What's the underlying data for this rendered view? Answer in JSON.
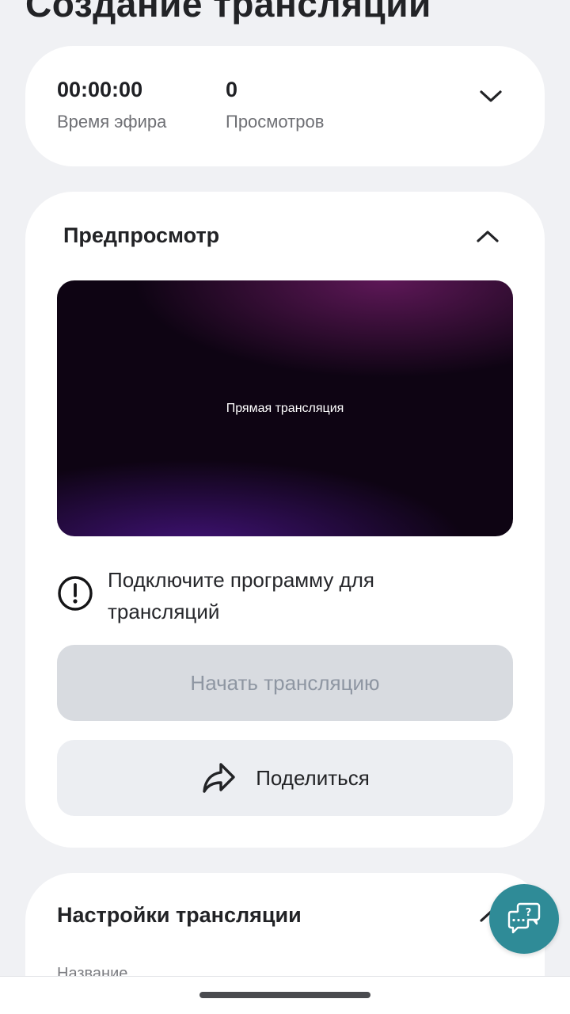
{
  "page": {
    "title": "Создание трансляции"
  },
  "stats": {
    "air_time_value": "00:00:00",
    "air_time_label": "Время эфира",
    "views_value": "0",
    "views_label": "Просмотров"
  },
  "preview": {
    "title": "Предпросмотр",
    "video_label": "Прямая трансляция",
    "notice_text": "Подключите программу для трансляций",
    "start_button_label": "Начать трансляцию",
    "share_button_label": "Поделиться"
  },
  "settings": {
    "title": "Настройки трансляции",
    "field_label": "Название"
  },
  "icons": {
    "stats_toggle": "chevron-down-icon",
    "preview_toggle": "chevron-up-icon",
    "settings_toggle": "chevron-up-icon",
    "notice": "exclamation-circle-icon",
    "share": "share-arrow-icon",
    "help": "chat-question-icon"
  },
  "colors": {
    "background": "#f0f1f4",
    "card": "#ffffff",
    "disabled_button": "#d8dbe0",
    "disabled_text": "#8e96a2",
    "secondary_button": "#eceef2",
    "help_fab": "#2f8b97"
  }
}
